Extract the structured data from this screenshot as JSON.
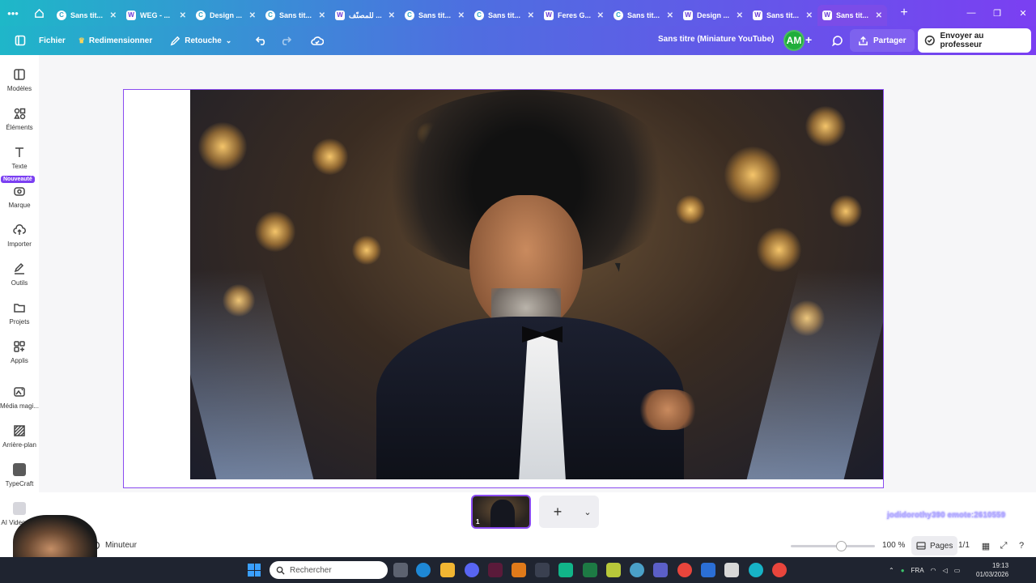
{
  "browser": {
    "tabs": [
      {
        "label": "Sans tit...",
        "favicon": "C",
        "active": false
      },
      {
        "label": "WEG - ...",
        "favicon": "W",
        "active": false
      },
      {
        "label": "Design ...",
        "favicon": "C",
        "active": false
      },
      {
        "label": "Sans tit...",
        "favicon": "C",
        "active": false
      },
      {
        "label": "للمصنّف ...",
        "favicon": "W",
        "active": false
      },
      {
        "label": "Sans tit...",
        "favicon": "C",
        "active": false
      },
      {
        "label": "Sans tit...",
        "favicon": "C",
        "active": false
      },
      {
        "label": "Feres G...",
        "favicon": "W",
        "active": false
      },
      {
        "label": "Sans tit...",
        "favicon": "C",
        "active": false
      },
      {
        "label": "Design ...",
        "favicon": "W",
        "active": false
      },
      {
        "label": "Sans tit...",
        "favicon": "W",
        "active": false
      },
      {
        "label": "Sans tit...",
        "favicon": "W",
        "active": true
      }
    ]
  },
  "header": {
    "file_label": "Fichier",
    "resize_label": "Redimensionner",
    "edit_label": "Retouche",
    "doc_title": "Sans titre (Miniature YouTube)",
    "avatar_initials": "AM",
    "share_label": "Partager",
    "send_label": "Envoyer au professeur"
  },
  "sidebar": {
    "new_badge": "Nouveauté",
    "items": [
      {
        "label": "Modèles",
        "icon": "templates-icon"
      },
      {
        "label": "Éléments",
        "icon": "elements-icon"
      },
      {
        "label": "Texte",
        "icon": "text-icon"
      },
      {
        "label": "Marque",
        "icon": "brand-icon"
      },
      {
        "label": "Importer",
        "icon": "upload-icon"
      },
      {
        "label": "Outils",
        "icon": "draw-icon"
      },
      {
        "label": "Projets",
        "icon": "folder-icon"
      },
      {
        "label": "Applis",
        "icon": "apps-icon"
      },
      {
        "label": "Média magi...",
        "icon": "magic-media-icon"
      },
      {
        "label": "Arrière-plan",
        "icon": "background-icon"
      },
      {
        "label": "TypeCraft",
        "icon": "typecraft-icon"
      },
      {
        "label": "AI Video G...",
        "icon": "ai-video-icon"
      }
    ]
  },
  "pages": {
    "thumb_number": "1"
  },
  "footer": {
    "timer_label": "Minuteur",
    "zoom_label": "100 %",
    "zoom_level_percent": 100,
    "pages_label": "Pages",
    "page_count": "1/1"
  },
  "overlay": {
    "watermark": "jodidorothy390 emote:2610559"
  },
  "taskbar": {
    "search_placeholder": "Rechercher",
    "language": "FRA",
    "time": "19:13",
    "date": "01/03/2026"
  },
  "colors": {
    "accent": "#7b3ff2",
    "header_start": "#1fb6c9",
    "header_end": "#7a3ef2",
    "canvas_bg": "#f6f6f8"
  }
}
